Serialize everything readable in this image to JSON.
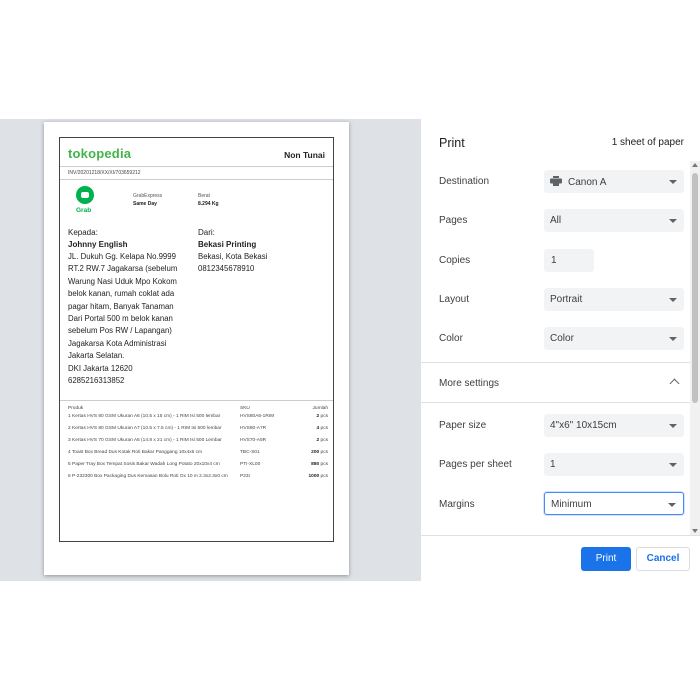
{
  "preview": {
    "logo": "tokopedia",
    "payment": "Non Tunai",
    "invoice": "INV/20201218/XX/XI/703659212",
    "courier_logo": "Grab",
    "courier_label": "GrabExpress",
    "courier_service": "Same Day",
    "weight_label": "Berat",
    "weight_value": "8.294 Kg",
    "to_label": "Kepada:",
    "to_name": "Johnny English",
    "to_address": [
      "JL. Dukuh Gg. Kelapa No.9999",
      "RT.2 RW.7 Jagakarsa (sebelum",
      "Warung Nasi Uduk Mpo Kokom",
      "belok kanan, rumah coklat ada",
      "pagar hitam, Banyak Tanaman",
      "Dari Portal 500 m belok kanan",
      "sebelum Pos RW / Lapangan)",
      "Jagakarsa Kota Administrasi",
      "Jakarta Selatan.",
      "DKI Jakarta 12620",
      "6285216313852"
    ],
    "from_label": "Dari:",
    "from_name": "Bekasi Printing",
    "from_address": [
      "Bekasi, Kota Bekasi",
      "0812345678910"
    ],
    "table": {
      "headers": [
        "Produk",
        "SKU",
        "Jumlah"
      ],
      "rows": [
        {
          "product": "1 Kertas HVS 80 GSM Ukuran A6 (10.5 x 15 cm) - 1 RIM Isi 500 lembar",
          "sku": "HVS80A6-1RIM",
          "qty": "2",
          "unit": "pcs"
        },
        {
          "product": "2 Kertas HVS 80 GSM Ukuran A7 (10.5 x 7.5 cm) - 1 RIM Isi 500 lembar",
          "sku": "HVS80-A7R",
          "qty": "4",
          "unit": "pcs"
        },
        {
          "product": "3 Kertas HVS 70 GSM Ukuran A5 (14.8 x 21 cm) - 1 RIM Isi 500 Lembar",
          "sku": "HVS70-A5R",
          "qty": "2",
          "unit": "pcs"
        },
        {
          "product": "4 Toast Box Bread Dus Kotak Roti Bakar Panggang 10x4x6 cm",
          "sku": "TBC-S01",
          "qty": "200",
          "unit": "pcs"
        },
        {
          "product": "5 Paper Tray Box Tempat Sosis Bakar Wadah Long Potato 20x10x4 cm",
          "sku": "PTI-XL00",
          "qty": "880",
          "unit": "pcs"
        },
        {
          "product": "6 P-232300 Box Packaging Dus Kemasan Bolu Roti Ox 10 m 2.3x2.3x0 cm",
          "sku": "P23I",
          "qty": "1000",
          "unit": "pcs"
        }
      ]
    }
  },
  "panel": {
    "title": "Print",
    "sheets": "1 sheet of paper",
    "destination": {
      "label": "Destination",
      "value": "Canon A"
    },
    "pages": {
      "label": "Pages",
      "value": "All"
    },
    "copies": {
      "label": "Copies",
      "value": "1"
    },
    "layout": {
      "label": "Layout",
      "value": "Portrait"
    },
    "color": {
      "label": "Color",
      "value": "Color"
    },
    "more_settings": "More settings",
    "paper_size": {
      "label": "Paper size",
      "value": "4\"x6\" 10x15cm"
    },
    "pages_per_sheet": {
      "label": "Pages per sheet",
      "value": "1"
    },
    "margins": {
      "label": "Margins",
      "value": "Minimum"
    },
    "print_button": "Print",
    "cancel_button": "Cancel",
    "accent_color": "#1a73e8"
  }
}
